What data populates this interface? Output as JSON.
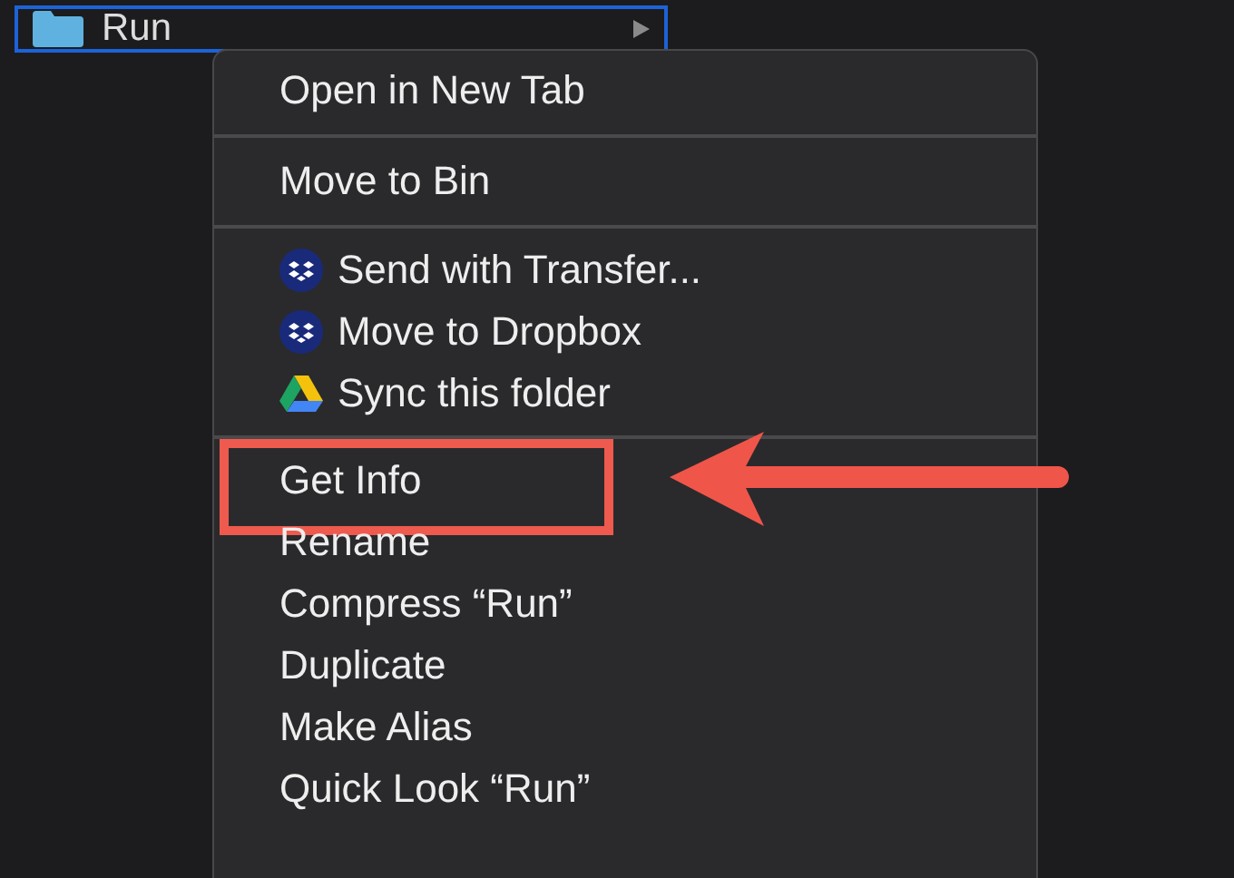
{
  "folder_row": {
    "name": "Run",
    "selected": true
  },
  "context_menu": {
    "items": [
      {
        "kind": "item",
        "label": "Open in New Tab"
      },
      {
        "kind": "separator"
      },
      {
        "kind": "item",
        "label": "Move to Bin"
      },
      {
        "kind": "separator"
      },
      {
        "kind": "dropbox",
        "label": "Send with Transfer..."
      },
      {
        "kind": "dropbox",
        "label": "Move to Dropbox"
      },
      {
        "kind": "drive",
        "label": "Sync this folder"
      },
      {
        "kind": "separator"
      },
      {
        "kind": "item",
        "label": "Get Info",
        "annotated": true
      },
      {
        "kind": "item",
        "label": "Rename"
      },
      {
        "kind": "item",
        "label": "Compress “Run”"
      },
      {
        "kind": "item",
        "label": "Duplicate"
      },
      {
        "kind": "item",
        "label": "Make Alias"
      },
      {
        "kind": "item",
        "label": "Quick Look “Run”"
      }
    ]
  }
}
